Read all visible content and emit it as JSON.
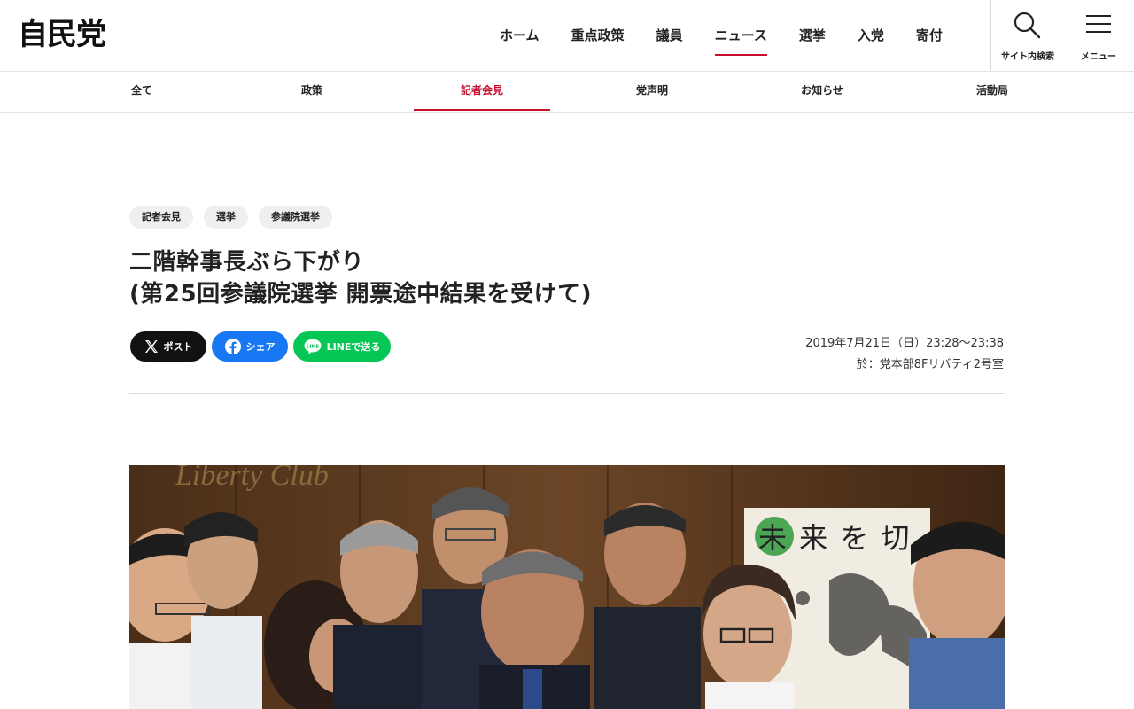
{
  "logo": "自民党",
  "main_nav": [
    {
      "label": "ホーム",
      "active": false
    },
    {
      "label": "重点政策",
      "active": false
    },
    {
      "label": "議員",
      "active": false
    },
    {
      "label": "ニュース",
      "active": true
    },
    {
      "label": "選挙",
      "active": false
    },
    {
      "label": "入党",
      "active": false
    },
    {
      "label": "寄付",
      "active": false
    }
  ],
  "utilities": {
    "search_label": "サイト内検索",
    "search_icon": "search-icon",
    "menu_label": "メニュー",
    "menu_icon": "hamburger-icon"
  },
  "sub_nav": [
    {
      "label": "全て",
      "active": false
    },
    {
      "label": "政策",
      "active": false
    },
    {
      "label": "記者会見",
      "active": true
    },
    {
      "label": "党声明",
      "active": false
    },
    {
      "label": "お知らせ",
      "active": false
    },
    {
      "label": "活動局",
      "active": false
    }
  ],
  "article": {
    "tags": [
      "記者会見",
      "選挙",
      "参議院選挙"
    ],
    "title_line1": "二階幹事長ぶら下がり",
    "title_line2": "(第25回参議院選挙 開票途中結果を受けて)",
    "date": "2019年7月21日（日）23:28～23:38",
    "location": "於：党本部8Fリバティ2号室",
    "share": {
      "x_label": "ポスト",
      "facebook_label": "シェア",
      "line_label": "LINEで送る",
      "line_icon_text": "LINE"
    },
    "photo": {
      "wall_sign": "Liberty Club",
      "poster_text": "未 来 を 切"
    }
  },
  "colors": {
    "accent": "#c8102e",
    "x": "#111111",
    "facebook": "#1877f2",
    "line": "#06c755",
    "tag_bg": "#efefef"
  }
}
